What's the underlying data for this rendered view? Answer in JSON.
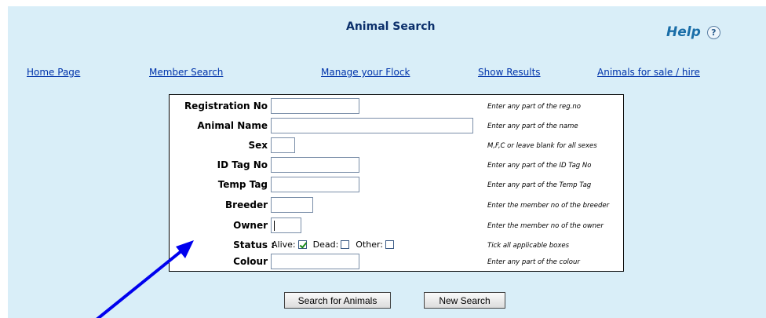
{
  "header": {
    "title": "Animal Search",
    "help_label": "Help",
    "help_icon_glyph": "?"
  },
  "nav": {
    "home": "Home Page",
    "member_search": "Member Search",
    "manage_flock": "Manage your Flock",
    "show_results": "Show Results",
    "animals_for_sale": "Animals for sale / hire"
  },
  "form": {
    "registration_no": {
      "label": "Registration No :",
      "value": "",
      "hint": "Enter any part of the reg.no"
    },
    "animal_name": {
      "label": "Animal Name :",
      "value": "",
      "hint": "Enter any part of the name"
    },
    "sex": {
      "label": "Sex :",
      "value": "",
      "hint": "M,F,C or leave blank for all sexes"
    },
    "id_tag_no": {
      "label": "ID Tag No :",
      "value": "",
      "hint": "Enter any part of the ID Tag No"
    },
    "temp_tag": {
      "label": "Temp Tag :",
      "value": "",
      "hint": "Enter any part of the Temp Tag"
    },
    "breeder": {
      "label": "Breeder :",
      "value": "",
      "hint": "Enter the member no of the breeder"
    },
    "owner": {
      "label": "Owner :",
      "value": "",
      "hint": "Enter the member no of the owner"
    },
    "status": {
      "label": "Status :",
      "hint": "Tick all applicable boxes",
      "alive_label": "Alive:",
      "alive_checked": true,
      "dead_label": "Dead:",
      "dead_checked": false,
      "other_label": "Other:",
      "other_checked": false
    },
    "colour": {
      "label": "Colour :",
      "value": "",
      "hint": "Enter any part of the colour"
    }
  },
  "buttons": {
    "search": "Search for Animals",
    "new_search": "New Search"
  },
  "colors": {
    "panel_bg": "#d9eef8",
    "link": "#0033aa",
    "title": "#0b2f6b",
    "annotation_arrow": "#0000ee"
  }
}
